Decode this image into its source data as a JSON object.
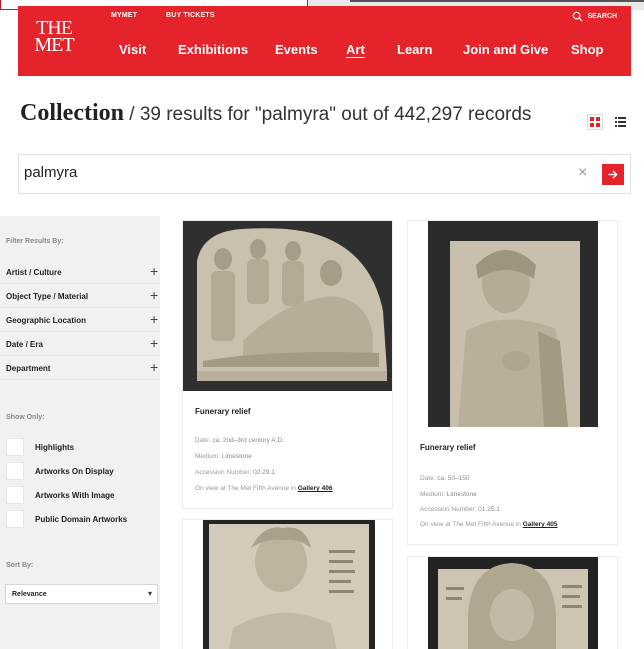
{
  "header": {
    "logo_line1": "THE",
    "logo_line2": "MET",
    "util_mymet": "MYMET",
    "util_tickets": "BUY TICKETS",
    "util_search": "SEARCH",
    "nav": [
      "Visit",
      "Exhibitions",
      "Events",
      "Art",
      "Learn",
      "Join and Give",
      "Shop"
    ],
    "active_nav": "Art"
  },
  "title": {
    "main": "Collection",
    "rest": " / 39 results for \"palmyra\" out of 442,297 records"
  },
  "search": {
    "value": "palmyra",
    "clear_glyph": "×"
  },
  "sidebar": {
    "filter_heading": "Filter Results By:",
    "filters": [
      "Artist / Culture",
      "Object Type / Material",
      "Geographic Location",
      "Date / Era",
      "Department"
    ],
    "show_heading": "Show Only:",
    "show_options": [
      "Highlights",
      "Artworks On Display",
      "Artworks With Image",
      "Public Domain Artworks"
    ],
    "sort_heading": "Sort By:",
    "sort_value": "Relevance"
  },
  "results": [
    {
      "title": "Funerary relief",
      "date_label": "Date:",
      "date": "ca. 2nd–3rd century A.D.",
      "medium_label": "Medium:",
      "medium": "Limestone",
      "accession_label": "Accession Number:",
      "accession": "02.29.1",
      "view_text": "On view at The Met Fifth Avenue in",
      "gallery": "Gallery 406"
    },
    {
      "title": "Funerary relief",
      "date_label": "Date:",
      "date": "ca. 50–150",
      "medium_label": "Medium:",
      "medium": "Limestone",
      "accession_label": "Accession Number:",
      "accession": "01.25.1",
      "view_text": "On view at The Met Fifth Avenue in",
      "gallery": "Gallery 405"
    }
  ],
  "colors": {
    "brand_red": "#e4232b",
    "sidebar_bg": "#f1f1f1"
  },
  "icons": [
    "search-icon",
    "grid-view-icon",
    "list-view-icon",
    "arrow-right-icon",
    "plus-icon",
    "caret-down-icon"
  ]
}
